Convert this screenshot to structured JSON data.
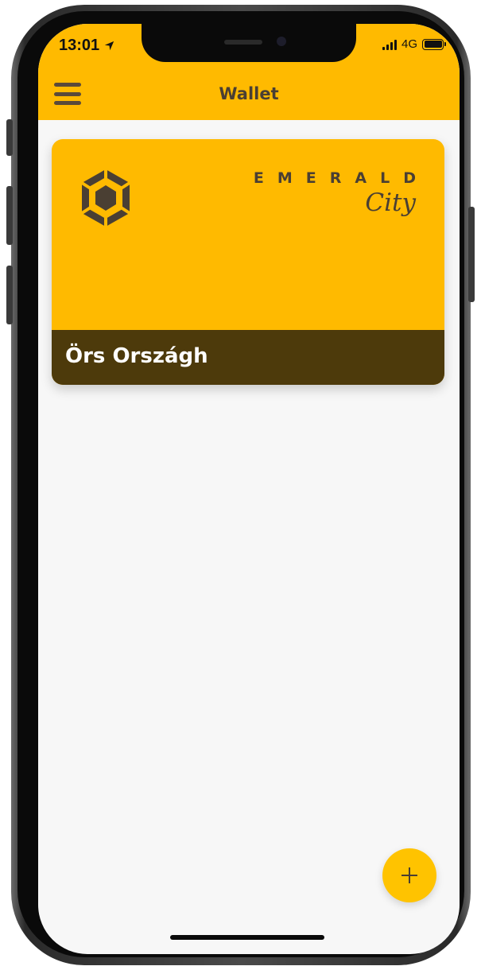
{
  "status_bar": {
    "time": "13:01",
    "location_icon": "location-arrow-icon",
    "network": "4G",
    "signal_icon": "signal-bars-icon",
    "battery_icon": "battery-full-icon"
  },
  "header": {
    "title": "Wallet",
    "menu_icon": "hamburger-menu-icon",
    "background": "#ffba00"
  },
  "card": {
    "brand_main": "EMERALD",
    "brand_sub": "City",
    "holder_name": "Örs Országh",
    "logo_icon": "hexagon-gem-icon",
    "background": "#ffba00",
    "footer_background": "#4d3a0b"
  },
  "fab": {
    "icon": "plus-icon",
    "background": "#ffc300"
  }
}
